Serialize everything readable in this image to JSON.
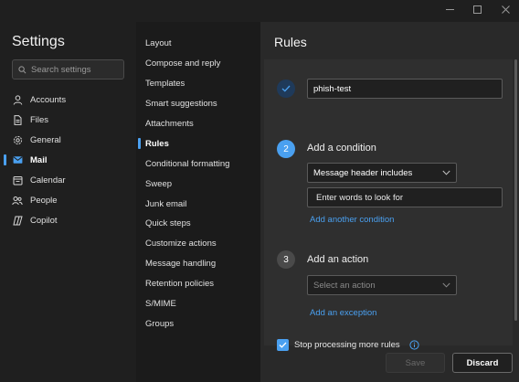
{
  "window": {
    "controls": [
      "minimize",
      "maximize",
      "close"
    ]
  },
  "settings": {
    "title": "Settings",
    "search_placeholder": "Search settings",
    "nav": [
      {
        "label": "Accounts",
        "icon": "person-icon"
      },
      {
        "label": "Files",
        "icon": "file-icon"
      },
      {
        "label": "General",
        "icon": "gear-icon"
      },
      {
        "label": "Mail",
        "icon": "mail-icon",
        "active": true
      },
      {
        "label": "Calendar",
        "icon": "calendar-icon"
      },
      {
        "label": "People",
        "icon": "people-icon"
      },
      {
        "label": "Copilot",
        "icon": "copilot-icon"
      }
    ]
  },
  "mail_menu": {
    "items": [
      {
        "label": "Layout"
      },
      {
        "label": "Compose and reply"
      },
      {
        "label": "Templates"
      },
      {
        "label": "Smart suggestions"
      },
      {
        "label": "Attachments"
      },
      {
        "label": "Rules",
        "active": true
      },
      {
        "label": "Conditional formatting"
      },
      {
        "label": "Sweep"
      },
      {
        "label": "Junk email"
      },
      {
        "label": "Quick steps"
      },
      {
        "label": "Customize actions"
      },
      {
        "label": "Message handling"
      },
      {
        "label": "Retention policies"
      },
      {
        "label": "S/MIME"
      },
      {
        "label": "Groups"
      }
    ]
  },
  "rules": {
    "title": "Rules",
    "rule_name": "phish-test",
    "step2_number": "2",
    "step2_label": "Add a condition",
    "condition_select": "Message header includes",
    "condition_words_placeholder": "Enter words to look for",
    "add_condition_link": "Add another condition",
    "step3_number": "3",
    "step3_label": "Add an action",
    "action_select_placeholder": "Select an action",
    "add_exception_link": "Add an exception",
    "stop_processing_label": "Stop processing more rules",
    "stop_processing_checked": true,
    "save_label": "Save",
    "discard_label": "Discard"
  },
  "colors": {
    "accent": "#4aa0f0",
    "background": "#1f1f1f",
    "panel": "#292929"
  }
}
